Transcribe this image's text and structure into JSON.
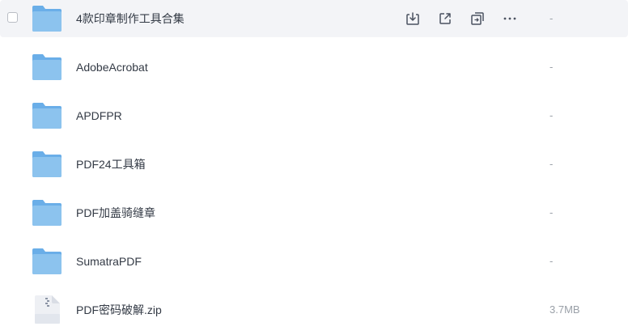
{
  "files": [
    {
      "name": "4款印章制作工具合集",
      "size": "-",
      "type": "folder-icon"
    },
    {
      "name": "AdobeAcrobat",
      "size": "-",
      "type": "folder-icon"
    },
    {
      "name": "APDFPR",
      "size": "-",
      "type": "folder-icon"
    },
    {
      "name": "PDF24工具箱",
      "size": "-",
      "type": "folder-icon"
    },
    {
      "name": "PDF加盖骑缝章",
      "size": "-",
      "type": "folder-icon"
    },
    {
      "name": "SumatraPDF",
      "size": "-",
      "type": "folder-icon"
    },
    {
      "name": "PDF密码破解.zip",
      "size": "3.7MB",
      "type": "zip-file-icon"
    }
  ],
  "row_actions": [
    "download-icon",
    "share-icon",
    "copy-to-icon",
    "more-icon"
  ],
  "colors": {
    "hover_bg": "#f3f4f7",
    "folder_blue": "#8cc3ee",
    "folder_back": "#6aaee8",
    "text": "#333a45",
    "size_text": "#9aa0a8",
    "icon": "#4b5260"
  }
}
